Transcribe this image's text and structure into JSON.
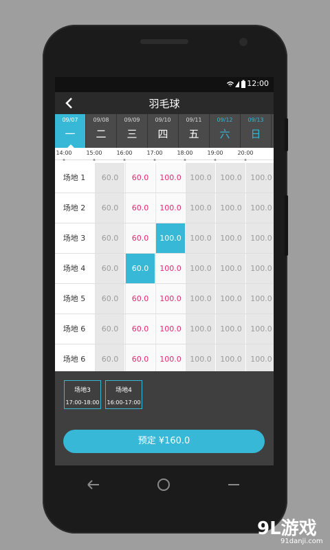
{
  "status": {
    "time": "12:00"
  },
  "header": {
    "title": "羽毛球"
  },
  "days": [
    {
      "date": "09/07",
      "weekday": "一",
      "active": true,
      "weekend": false
    },
    {
      "date": "09/08",
      "weekday": "二",
      "active": false,
      "weekend": false
    },
    {
      "date": "09/09",
      "weekday": "三",
      "active": false,
      "weekend": false
    },
    {
      "date": "09/10",
      "weekday": "四",
      "active": false,
      "weekend": false
    },
    {
      "date": "09/11",
      "weekday": "五",
      "active": false,
      "weekend": false
    },
    {
      "date": "09/12",
      "weekday": "六",
      "active": false,
      "weekend": true
    },
    {
      "date": "09/13",
      "weekday": "日",
      "active": false,
      "weekend": true
    }
  ],
  "times": [
    "14:00",
    "15:00",
    "16:00",
    "17:00",
    "18:00",
    "19:00",
    "20:00",
    "2"
  ],
  "courts": [
    {
      "name": "场地 1",
      "prices": [
        "60.0",
        "60.0",
        "100.0",
        "100.0",
        "100.0",
        "100.0"
      ],
      "states": [
        "gray",
        "pink",
        "pink",
        "gray",
        "gray",
        "gray"
      ]
    },
    {
      "name": "场地 2",
      "prices": [
        "60.0",
        "60.0",
        "100.0",
        "100.0",
        "100.0",
        "100.0"
      ],
      "states": [
        "gray",
        "pink",
        "pink",
        "gray",
        "gray",
        "gray"
      ]
    },
    {
      "name": "场地 3",
      "prices": [
        "60.0",
        "60.0",
        "100.0",
        "100.0",
        "100.0",
        "100.0"
      ],
      "states": [
        "gray",
        "pink",
        "sel",
        "gray",
        "gray",
        "gray"
      ]
    },
    {
      "name": "场地 4",
      "prices": [
        "60.0",
        "60.0",
        "100.0",
        "100.0",
        "100.0",
        "100.0"
      ],
      "states": [
        "gray",
        "sel",
        "pink",
        "gray",
        "gray",
        "gray"
      ]
    },
    {
      "name": "场地 5",
      "prices": [
        "60.0",
        "60.0",
        "100.0",
        "100.0",
        "100.0",
        "100.0"
      ],
      "states": [
        "gray",
        "pink",
        "pink",
        "gray",
        "gray",
        "gray"
      ]
    },
    {
      "name": "场地 6",
      "prices": [
        "60.0",
        "60.0",
        "100.0",
        "100.0",
        "100.0",
        "100.0"
      ],
      "states": [
        "gray",
        "pink",
        "pink",
        "gray",
        "gray",
        "gray"
      ]
    },
    {
      "name": "场地 6",
      "prices": [
        "60.0",
        "60.0",
        "100.0",
        "100.0",
        "100.0",
        "100.0"
      ],
      "states": [
        "gray",
        "pink",
        "pink",
        "gray",
        "gray",
        "gray"
      ]
    }
  ],
  "selected": [
    {
      "court": "场地3",
      "time": "17:00-18:00"
    },
    {
      "court": "场地4",
      "time": "16:00-17:00"
    }
  ],
  "book_button": {
    "label": "预定 ¥160.0"
  },
  "watermark": {
    "brand": "9L游戏",
    "site": "91danji.com"
  },
  "colors": {
    "accent": "#36b8d6",
    "price_highlight": "#e3266f",
    "unavailable": "#e7e7e7"
  }
}
